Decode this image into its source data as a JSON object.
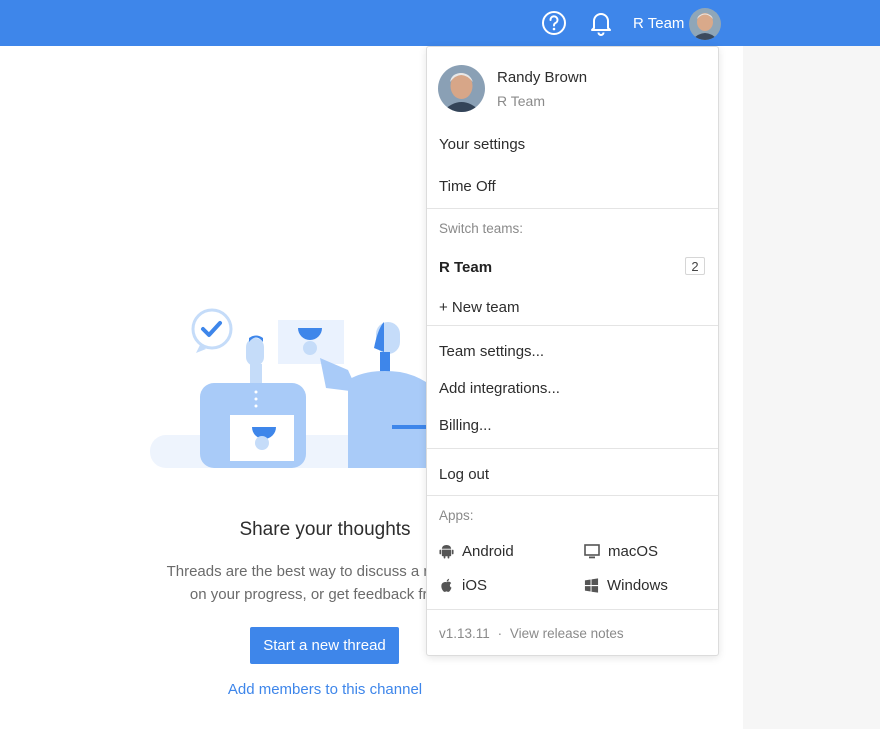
{
  "topbar": {
    "team_name": "R Team",
    "color": "#3e86ea",
    "icons": [
      "help-icon",
      "bell-icon",
      "avatar"
    ]
  },
  "empty_state": {
    "title": "Share your thoughts",
    "description_line1": "Threads are the best way to discuss a new idea",
    "description_line2": "on your progress, or get feedback from y",
    "button_label": "Start a new thread",
    "add_members_link": "Add members to this channel"
  },
  "dropdown": {
    "user": {
      "name": "Randy Brown",
      "team": "R Team"
    },
    "items_top": [
      "Your settings",
      "Time Off"
    ],
    "switch_label": "Switch teams:",
    "current_team": "R Team",
    "current_team_count": "2",
    "new_team": "+ New team",
    "team_items": [
      "Team settings...",
      "Add integrations...",
      "Billing..."
    ],
    "logout": "Log out",
    "apps_label": "Apps:",
    "apps": [
      {
        "label": "Android",
        "icon": "android-icon"
      },
      {
        "label": "macOS",
        "icon": "monitor-icon"
      },
      {
        "label": "iOS",
        "icon": "apple-icon"
      },
      {
        "label": "Windows",
        "icon": "windows-icon"
      }
    ],
    "version": "v1.13.11",
    "separator": "·",
    "release_notes": "View release notes"
  }
}
